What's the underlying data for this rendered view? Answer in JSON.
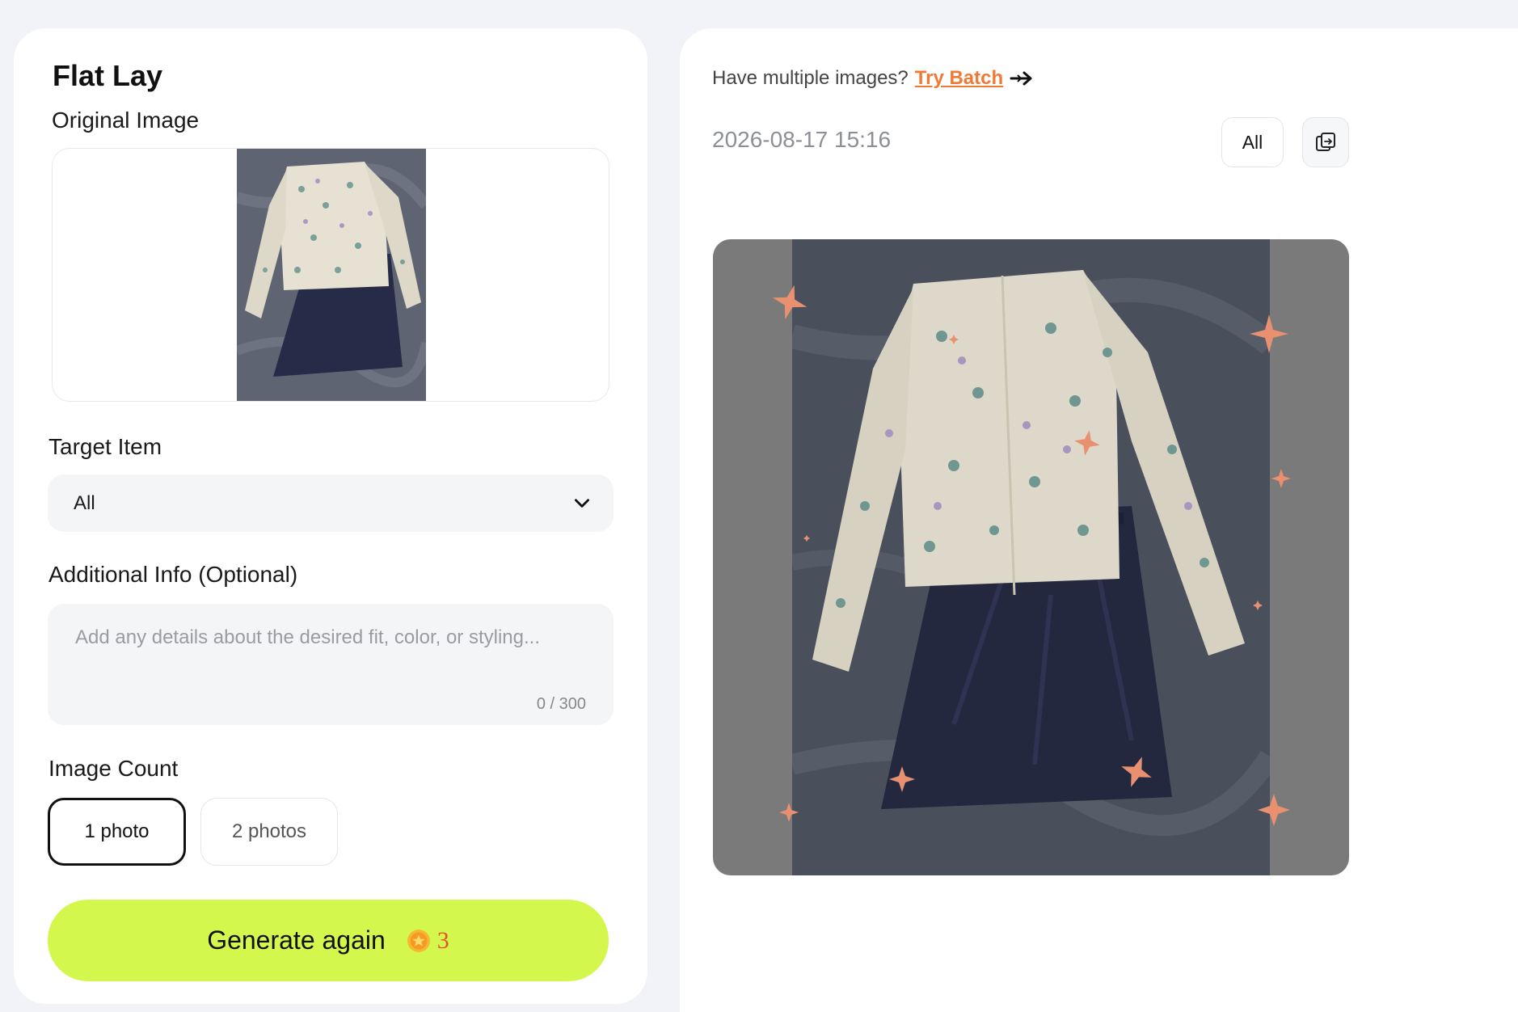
{
  "left": {
    "title": "Flat Lay",
    "original_image_label": "Original Image",
    "target_item": {
      "label": "Target Item",
      "selected": "All"
    },
    "additional_info": {
      "label": "Additional Info (Optional)",
      "placeholder": "Add any details about the desired fit, color, or styling...",
      "value": "",
      "counter": "0 / 300"
    },
    "image_count": {
      "label": "Image Count",
      "options": [
        "1 photo",
        "2 photos"
      ],
      "selected": "1 photo"
    },
    "generate": {
      "label": "Generate again",
      "cost": "3",
      "coin_icon": "coin-icon"
    }
  },
  "right": {
    "batch_prompt": "Have multiple images?",
    "batch_link": "Try Batch",
    "timestamp": "2026-08-17 15:16",
    "filter_label": "All",
    "compare_icon": "compare-images-icon"
  },
  "colors": {
    "accent_green": "#d4f74e",
    "link_orange": "#f07a35",
    "cost_red": "#e8502c",
    "sparkle": "#e89070"
  }
}
